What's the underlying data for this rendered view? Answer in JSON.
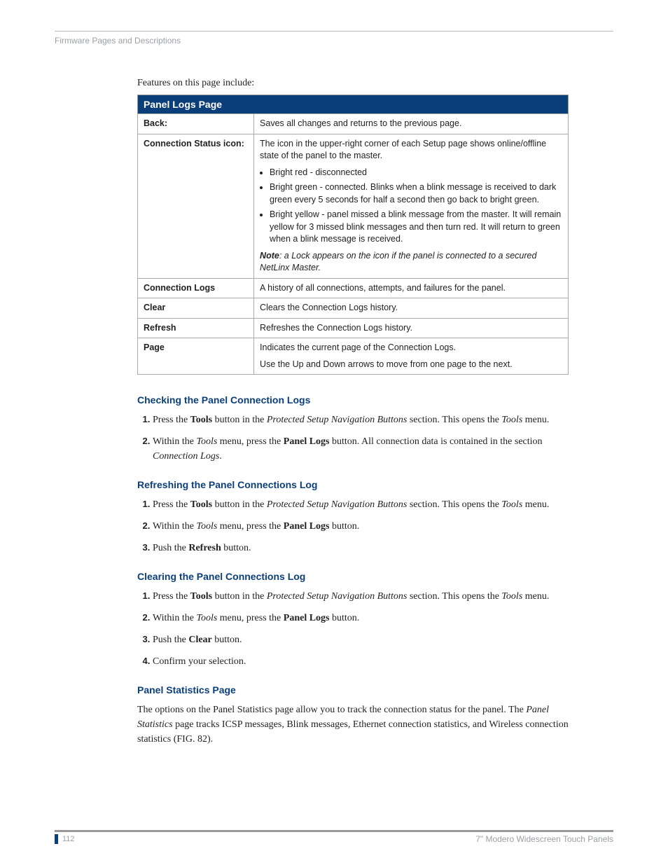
{
  "header": "Firmware Pages and Descriptions",
  "intro": "Features on this page include:",
  "table": {
    "title": "Panel Logs Page",
    "rows": {
      "back": {
        "label": "Back:",
        "desc": "Saves all changes and returns to the previous page."
      },
      "conn_status": {
        "label": "Connection Status icon:",
        "line1": "The icon in the upper-right corner of each Setup page shows online/offline state of the panel to the master.",
        "b1": "Bright red - disconnected",
        "b2": "Bright green - connected. Blinks when a blink message is received to dark green every 5 seconds for half a second then go back to bright green.",
        "b3": "Bright yellow - panel missed a blink message from the master. It will remain yellow for 3 missed blink messages and then turn red. It will return to green when a blink message is received.",
        "note_label": "Note",
        "note_text": ": a Lock appears on the icon if the panel is connected to a secured NetLinx Master."
      },
      "conn_logs": {
        "label": "Connection Logs",
        "desc": "A history of all connections, attempts, and failures for the panel."
      },
      "clear": {
        "label": "Clear",
        "desc": "Clears the Connection Logs history."
      },
      "refresh": {
        "label": "Refresh",
        "desc": "Refreshes the Connection Logs history."
      },
      "page": {
        "label": "Page",
        "desc": "Indicates the current page of the Connection Logs.",
        "sub": "Use the Up and Down arrows to move from one page to the next."
      }
    }
  },
  "sections": {
    "checking": {
      "title": "Checking the Panel Connection Logs",
      "s1a": "Press the ",
      "s1b": "Tools",
      "s1c": " button in the ",
      "s1d": "Protected Setup Navigation Buttons",
      "s1e": " section. This opens the ",
      "s1f": "Tools",
      "s1g": " menu.",
      "s2a": "Within the ",
      "s2b": "Tools",
      "s2c": " menu, press the ",
      "s2d": "Panel Logs",
      "s2e": " button. All connection data is contained in the section ",
      "s2f": "Connection Logs",
      "s2g": "."
    },
    "refreshing": {
      "title": "Refreshing the Panel Connections Log",
      "s1a": "Press the ",
      "s1b": "Tools",
      "s1c": " button in the ",
      "s1d": "Protected Setup Navigation Buttons",
      "s1e": " section. This opens the ",
      "s1f": "Tools",
      "s1g": " menu.",
      "s2a": "Within the ",
      "s2b": "Tools",
      "s2c": " menu, press the ",
      "s2d": "Panel Logs",
      "s2e": " button.",
      "s3a": "Push the ",
      "s3b": "Refresh",
      "s3c": " button."
    },
    "clearing": {
      "title": "Clearing the Panel Connections Log",
      "s1a": "Press the ",
      "s1b": "Tools",
      "s1c": " button in the ",
      "s1d": "Protected Setup Navigation Buttons",
      "s1e": " section. This opens the ",
      "s1f": "Tools",
      "s1g": " menu.",
      "s2a": "Within the ",
      "s2b": "Tools",
      "s2c": " menu, press the ",
      "s2d": "Panel Logs",
      "s2e": " button.",
      "s3a": "Push the ",
      "s3b": "Clear",
      "s3c": " button.",
      "s4a": "Confirm your selection."
    },
    "stats": {
      "title": "Panel Statistics Page",
      "p1a": "The options on the Panel Statistics page allow you to track the connection status for the panel. The ",
      "p1b": "Panel Statistics",
      "p1c": " page tracks ICSP messages, Blink messages, Ethernet connection statistics, and Wireless connection statistics (FIG. 82)."
    }
  },
  "footer": {
    "page_num": "112",
    "right": "7\" Modero Widescreen Touch Panels"
  }
}
